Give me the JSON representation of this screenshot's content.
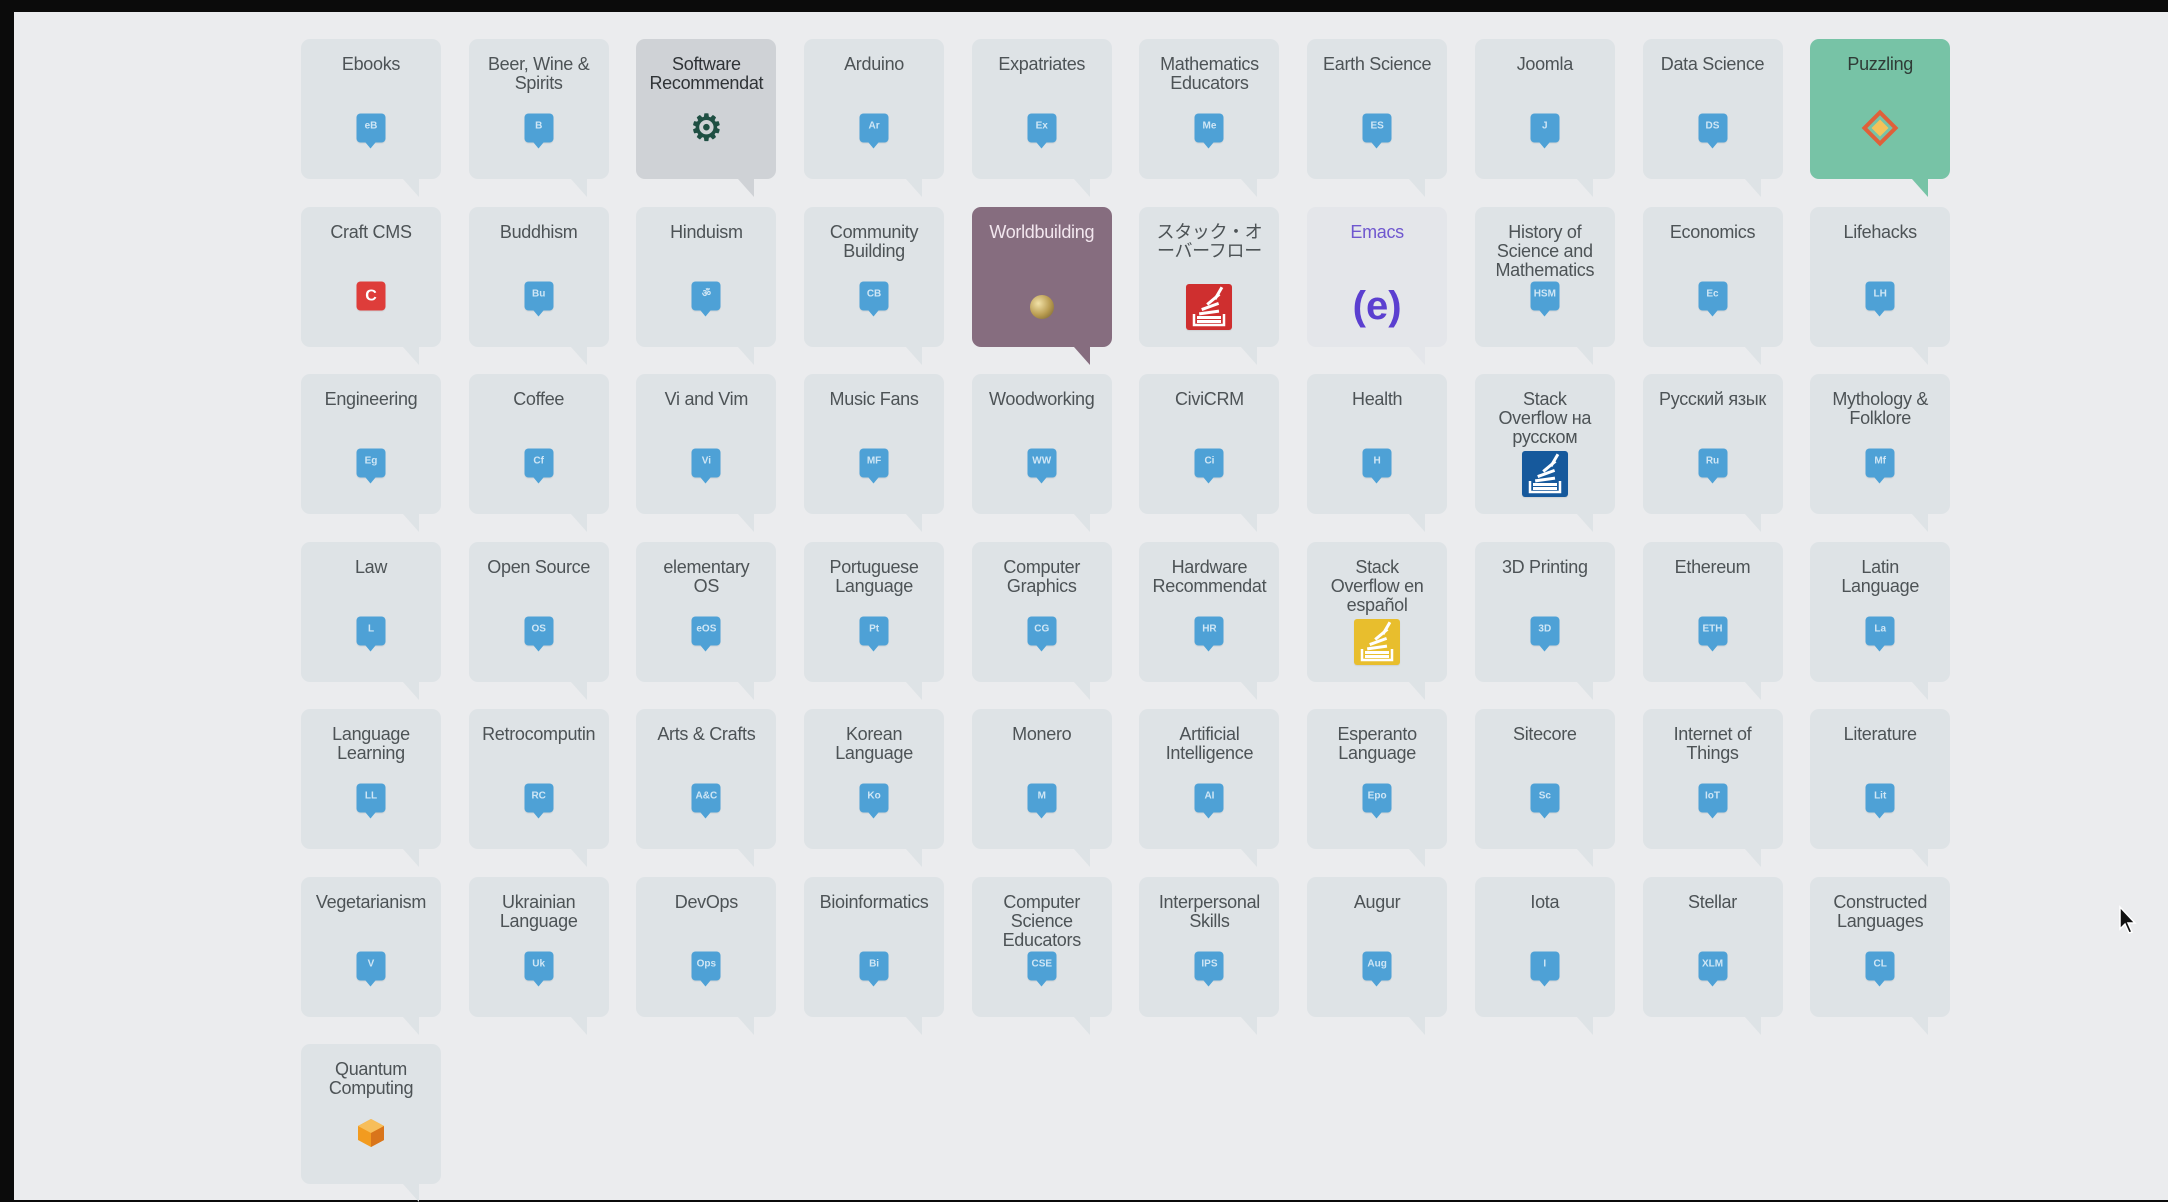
{
  "sites": [
    {
      "name": "Ebooks",
      "icon": "ebooks-icon",
      "abbr": "eB"
    },
    {
      "name": "Beer, Wine &\nSpirits",
      "icon": "beer-icon",
      "abbr": "B"
    },
    {
      "name": "Software\nRecommendat",
      "icon": "gear-icon",
      "abbr": "⚙",
      "variant": "software"
    },
    {
      "name": "Arduino",
      "icon": "arduino-icon",
      "abbr": "Ar"
    },
    {
      "name": "Expatriates",
      "icon": "expatriates-icon",
      "abbr": "Ex"
    },
    {
      "name": "Mathematics\nEducators",
      "icon": "math-educators-icon",
      "abbr": "Me"
    },
    {
      "name": "Earth Science",
      "icon": "earth-science-icon",
      "abbr": "ES"
    },
    {
      "name": "Joomla",
      "icon": "joomla-icon",
      "abbr": "J"
    },
    {
      "name": "Data Science",
      "icon": "data-science-icon",
      "abbr": "DS"
    },
    {
      "name": "Puzzling",
      "icon": "puzzle-icon",
      "abbr": "",
      "variant": "puzzling"
    },
    {
      "name": "Craft CMS",
      "icon": "craft-cms-icon",
      "abbr": "C",
      "variant": "craft"
    },
    {
      "name": "Buddhism",
      "icon": "buddhism-icon",
      "abbr": "Bu"
    },
    {
      "name": "Hinduism",
      "icon": "hinduism-icon",
      "abbr": "ॐ"
    },
    {
      "name": "Community\nBuilding",
      "icon": "community-building-icon",
      "abbr": "CB"
    },
    {
      "name": "Worldbuilding",
      "icon": "planet-icon",
      "abbr": "",
      "variant": "world"
    },
    {
      "name": "スタック・オ\nーバーフロー",
      "icon": "stack-overflow-ja-icon",
      "abbr": "",
      "variant": "stack-red"
    },
    {
      "name": "Emacs",
      "icon": "emacs-icon",
      "abbr": "(e)",
      "variant": "emacs"
    },
    {
      "name": "History of\nScience and\nMathematics",
      "icon": "history-science-icon",
      "abbr": "HSM"
    },
    {
      "name": "Economics",
      "icon": "economics-icon",
      "abbr": "Ec"
    },
    {
      "name": "Lifehacks",
      "icon": "lifehacks-icon",
      "abbr": "LH"
    },
    {
      "name": "Engineering",
      "icon": "engineering-icon",
      "abbr": "Eg"
    },
    {
      "name": "Coffee",
      "icon": "coffee-icon",
      "abbr": "Cf"
    },
    {
      "name": "Vi and Vim",
      "icon": "vim-icon",
      "abbr": "Vi"
    },
    {
      "name": "Music Fans",
      "icon": "music-fans-icon",
      "abbr": "MF"
    },
    {
      "name": "Woodworking",
      "icon": "woodworking-icon",
      "abbr": "WW"
    },
    {
      "name": "CiviCRM",
      "icon": "civicrm-icon",
      "abbr": "Ci"
    },
    {
      "name": "Health",
      "icon": "health-icon",
      "abbr": "H"
    },
    {
      "name": "Stack\nOverflow на\nрусском",
      "icon": "stack-overflow-ru-icon",
      "abbr": "",
      "variant": "stack-blue"
    },
    {
      "name": "Русский язык",
      "icon": "russian-language-icon",
      "abbr": "Ru"
    },
    {
      "name": "Mythology &\nFolklore",
      "icon": "mythology-icon",
      "abbr": "Mf"
    },
    {
      "name": "Law",
      "icon": "law-icon",
      "abbr": "L"
    },
    {
      "name": "Open Source",
      "icon": "open-source-icon",
      "abbr": "OS"
    },
    {
      "name": "elementary\nOS",
      "icon": "elementary-os-icon",
      "abbr": "eOS"
    },
    {
      "name": "Portuguese\nLanguage",
      "icon": "portuguese-icon",
      "abbr": "Pt"
    },
    {
      "name": "Computer\nGraphics",
      "icon": "computer-graphics-icon",
      "abbr": "CG"
    },
    {
      "name": "Hardware\nRecommendat",
      "icon": "hardware-icon",
      "abbr": "HR"
    },
    {
      "name": "Stack\nOverflow en\nespañol",
      "icon": "stack-overflow-es-icon",
      "abbr": "",
      "variant": "stack-yellow"
    },
    {
      "name": "3D Printing",
      "icon": "3d-printing-icon",
      "abbr": "3D"
    },
    {
      "name": "Ethereum",
      "icon": "ethereum-icon",
      "abbr": "ETH"
    },
    {
      "name": "Latin\nLanguage",
      "icon": "latin-icon",
      "abbr": "La"
    },
    {
      "name": "Language\nLearning",
      "icon": "language-learning-icon",
      "abbr": "LL"
    },
    {
      "name": "Retrocomputin",
      "icon": "retrocomputing-icon",
      "abbr": "RC"
    },
    {
      "name": "Arts & Crafts",
      "icon": "arts-crafts-icon",
      "abbr": "A&C"
    },
    {
      "name": "Korean\nLanguage",
      "icon": "korean-icon",
      "abbr": "Ko"
    },
    {
      "name": "Monero",
      "icon": "monero-icon",
      "abbr": "M"
    },
    {
      "name": "Artificial\nIntelligence",
      "icon": "ai-icon",
      "abbr": "AI"
    },
    {
      "name": "Esperanto\nLanguage",
      "icon": "esperanto-icon",
      "abbr": "Epo"
    },
    {
      "name": "Sitecore",
      "icon": "sitecore-icon",
      "abbr": "Sc"
    },
    {
      "name": "Internet of\nThings",
      "icon": "iot-icon",
      "abbr": "IoT"
    },
    {
      "name": "Literature",
      "icon": "literature-icon",
      "abbr": "Lit"
    },
    {
      "name": "Vegetarianism",
      "icon": "vegetarianism-icon",
      "abbr": "V"
    },
    {
      "name": "Ukrainian\nLanguage",
      "icon": "ukrainian-icon",
      "abbr": "Uk"
    },
    {
      "name": "DevOps",
      "icon": "devops-icon",
      "abbr": "Ops"
    },
    {
      "name": "Bioinformatics",
      "icon": "bioinformatics-icon",
      "abbr": "Bi"
    },
    {
      "name": "Computer\nScience\nEducators",
      "icon": "cs-educators-icon",
      "abbr": "CSE"
    },
    {
      "name": "Interpersonal\nSkills",
      "icon": "interpersonal-icon",
      "abbr": "IPS"
    },
    {
      "name": "Augur",
      "icon": "augur-icon",
      "abbr": "Aug"
    },
    {
      "name": "Iota",
      "icon": "iota-icon",
      "abbr": "I"
    },
    {
      "name": "Stellar",
      "icon": "stellar-icon",
      "abbr": "XLM"
    },
    {
      "name": "Constructed\nLanguages",
      "icon": "conlang-icon",
      "abbr": "CL"
    },
    {
      "name": "Quantum\nComputing",
      "icon": "quantum-icon",
      "abbr": "",
      "variant": "quantum"
    }
  ],
  "colors": {
    "page_bg": "#ebecee",
    "tile_bg": "#dee3e6",
    "icon_blue": "#4ea1d6",
    "puzzling": "#77c3a6",
    "worldbuilding": "#866d7f",
    "emacs": "#5b3fd0"
  },
  "cursor": {
    "icon": "mouse-pointer-icon"
  }
}
